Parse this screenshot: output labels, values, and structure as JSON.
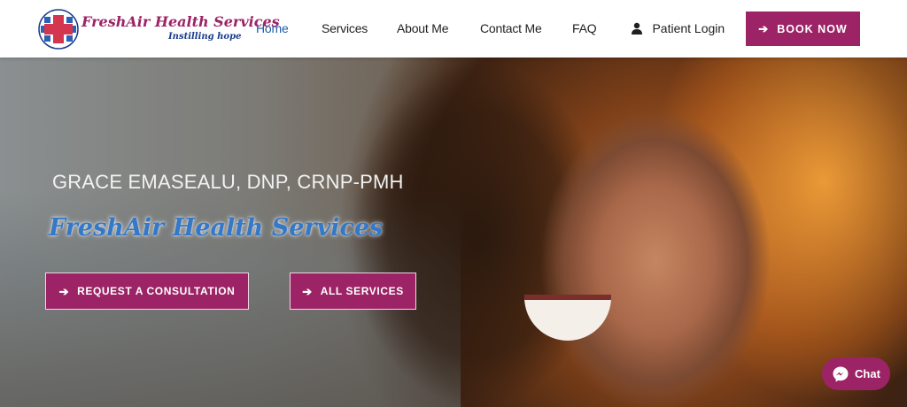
{
  "header": {
    "logo": {
      "name": "FreshAir Health Services",
      "tagline": "Instilling hope",
      "icon": "medical-cross-logo-icon"
    },
    "nav": [
      {
        "label": "Home",
        "active": true
      },
      {
        "label": "Services",
        "active": false
      },
      {
        "label": "About Me",
        "active": false
      },
      {
        "label": "Contact Me",
        "active": false
      },
      {
        "label": "FAQ",
        "active": false
      }
    ],
    "login": {
      "label": "Patient Login",
      "icon": "user-icon"
    },
    "cta": {
      "label": "BOOK NOW",
      "icon": "arrow-right-icon"
    }
  },
  "hero": {
    "subtitle": "GRACE EMASEALU, DNP, CRNP-PMH",
    "title": "FreshAir Health Services",
    "buttons": [
      {
        "label": "REQUEST A CONSULTATION",
        "icon": "arrow-right-icon"
      },
      {
        "label": "ALL SERVICES",
        "icon": "arrow-right-icon"
      }
    ]
  },
  "chat": {
    "label": "Chat",
    "icon": "messenger-icon"
  },
  "colors": {
    "brand": "#9c2466",
    "nav_active": "#1f5ba6",
    "hero_title": "#3478c8",
    "text_dark": "#1f1f1f"
  }
}
